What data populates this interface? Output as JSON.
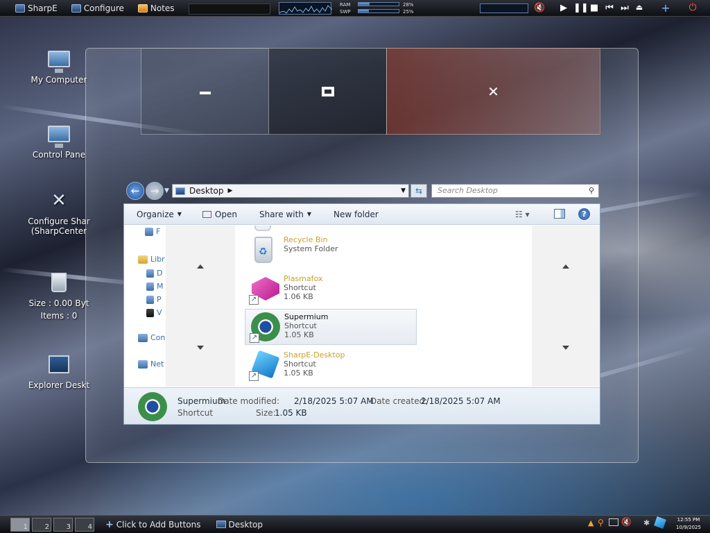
{
  "topbar": {
    "buttons": [
      {
        "label": "SharpE",
        "icon": "sharpe-icon"
      },
      {
        "label": "Configure",
        "icon": "configure-icon"
      },
      {
        "label": "Notes",
        "icon": "notes-icon"
      }
    ],
    "terminal_icon": "terminal-icon",
    "ram_label": "RAM",
    "ram_percent": "28%",
    "swap_label": "SWP",
    "swap_percent": "25%",
    "ram_fraction": 0.28,
    "swap_fraction": 0.25,
    "media": [
      "play",
      "pause",
      "stop",
      "previous",
      "next"
    ]
  },
  "desktop_icons": [
    {
      "label": "My Computer",
      "icon": "computer-icon"
    },
    {
      "label": "Control Pane",
      "icon": "control-panel-icon"
    },
    {
      "label": "Configure Shar",
      "label2": "(SharpCenter",
      "icon": "tools-icon"
    },
    {
      "label": "Size : 0.00 Byt",
      "label2": "Items : 0",
      "icon": "recycle-bin-icon"
    },
    {
      "label": "Explorer Deskt",
      "icon": "explorer-icon"
    }
  ],
  "caption_buttons": {
    "minimize": "–",
    "maximize": "▣",
    "close": "✕"
  },
  "explorer": {
    "address": "Desktop",
    "search_placeholder": "Search Desktop",
    "commands": {
      "organize": "Organize",
      "open": "Open",
      "share": "Share with",
      "new_folder": "New folder"
    },
    "nav_items": [
      "F",
      "Libr",
      "D",
      "M",
      "P",
      "V",
      "Con",
      "Net"
    ],
    "files": [
      {
        "name": "Recycle Bin",
        "type": "System Folder",
        "size": ""
      },
      {
        "name": "Plasmafox",
        "type": "Shortcut",
        "size": "1.06 KB"
      },
      {
        "name": "Supermium",
        "type": "Shortcut",
        "size": "1.05 KB"
      },
      {
        "name": "SharpE-Desktop",
        "type": "Shortcut",
        "size": "1.05 KB"
      }
    ],
    "details": {
      "name": "Supermium",
      "type": "Shortcut",
      "modified_label": "Date modified:",
      "modified_value": "2/18/2025 5:07 AM",
      "created_label": "Date created:",
      "created_value": "2/18/2025 5:07 AM",
      "size_label": "Size:",
      "size_value": "1.05 KB"
    }
  },
  "taskbar": {
    "workspaces": [
      "1",
      "2",
      "3",
      "4"
    ],
    "add_buttons": "Click to Add Buttons",
    "task": "Desktop",
    "time": "12:55 PM",
    "date": "10/9/2025"
  }
}
